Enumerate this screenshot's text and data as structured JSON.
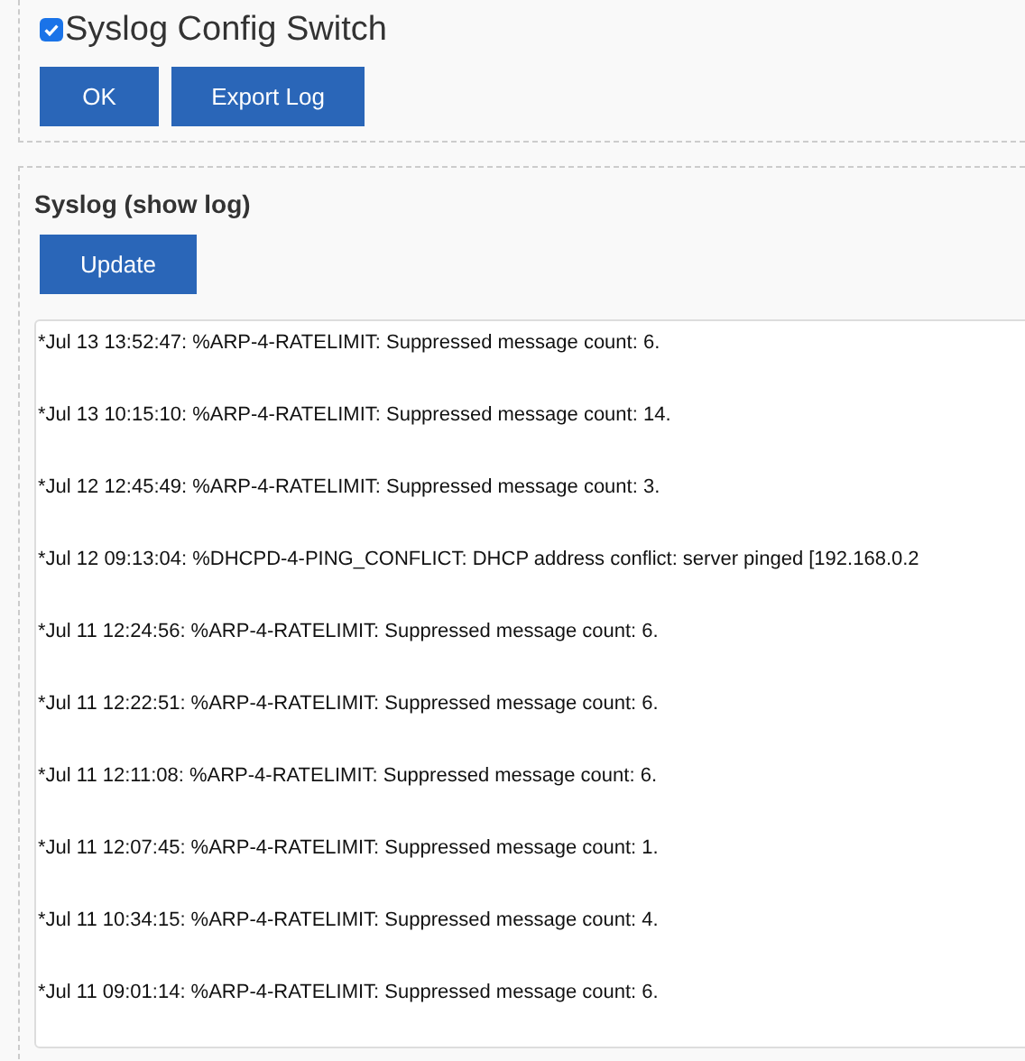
{
  "config": {
    "checked": true,
    "label": "Syslog Config Switch",
    "buttons": [
      "OK",
      "Export Log"
    ]
  },
  "syslog": {
    "title": "Syslog (show log)",
    "button": "Update",
    "lines": [
      "*Jul 13 13:52:47: %ARP-4-RATELIMIT: Suppressed message count: 6.",
      "*Jul 13 10:15:10: %ARP-4-RATELIMIT: Suppressed message count: 14.",
      "*Jul 12 12:45:49: %ARP-4-RATELIMIT: Suppressed message count: 3.",
      "*Jul 12 09:13:04: %DHCPD-4-PING_CONFLICT: DHCP address conflict: server pinged [192.168.0.2",
      "*Jul 11 12:24:56: %ARP-4-RATELIMIT: Suppressed message count: 6.",
      "*Jul 11 12:22:51: %ARP-4-RATELIMIT: Suppressed message count: 6.",
      "*Jul 11 12:11:08: %ARP-4-RATELIMIT: Suppressed message count: 6.",
      "*Jul 11 12:07:45: %ARP-4-RATELIMIT: Suppressed message count: 1.",
      "*Jul 11 10:34:15: %ARP-4-RATELIMIT: Suppressed message count: 4.",
      "*Jul 11 09:01:14: %ARP-4-RATELIMIT: Suppressed message count: 6."
    ]
  }
}
